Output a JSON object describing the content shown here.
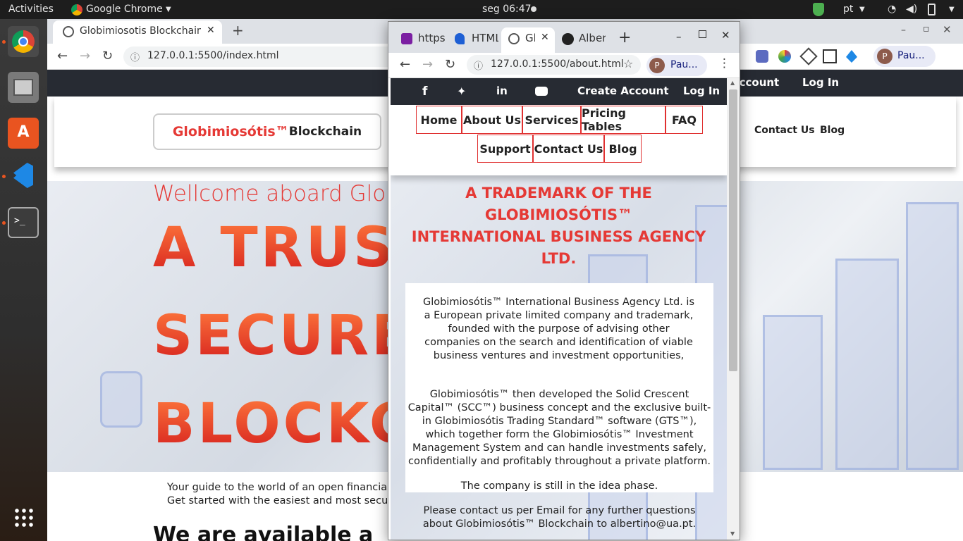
{
  "topbar": {
    "activities": "Activities",
    "app": "Google Chrome",
    "clock": "seg 06:47",
    "lang": "pt"
  },
  "dock": {
    "items": [
      "chrome-icon",
      "files-icon",
      "software-icon",
      "vscode-icon",
      "terminal-icon",
      "apps-grid-icon"
    ]
  },
  "bg": {
    "tab_title": "Globimiosotis Blockchain",
    "url": "127.0.0.1:5500/index.html",
    "profile": "Pau...",
    "nav": {
      "account": "Account",
      "login": "Log In"
    },
    "logo_red": "Globimiosótis™",
    "logo_dark": "Blockchain",
    "header_links": [
      "Contact Us",
      "Blog"
    ],
    "welcome": "Wellcome aboard Globim",
    "hero_lines": [
      "A TRUST",
      "SECURE",
      "BLOCKC"
    ],
    "guide1": "Your guide to the world of an open financial s",
    "guide2": "Get started with the easiest and most secure",
    "available": "We are available a"
  },
  "fg": {
    "tabs": [
      "https",
      "HTML",
      "Gl",
      "Alber"
    ],
    "url": "127.0.0.1:5500/about.html",
    "profile": "Pau...",
    "nav": {
      "create": "Create Account",
      "login": "Log In"
    },
    "menu": [
      "Home",
      "About Us",
      "Services",
      "Pricing Tables",
      "FAQ",
      "Support",
      "Contact Us",
      "Blog"
    ],
    "trademark": [
      "A TRADEMARK OF THE",
      "GLOBIMIOSÓTIS™",
      "INTERNATIONAL BUSINESS AGENCY",
      "LTD."
    ],
    "p1": "Globimiosótis™ International Business Agency Ltd. is a European private limited company and trademark, founded with the purpose of advising other companies on the search and identification of viable business ventures and investment opportunities,",
    "p2": "Globimiosótis™ then developed the Solid Crescent Capital™ (SCC™) business concept and the exclusive built-in Globimiosótis Trading Standard™ software (GTS™), which together form the Globimiosótis™ Investment Management System and can handle investments safely, confidentially and profitably throughout a private platform.",
    "p3": "The company is still in the idea phase.",
    "p4": "Please contact us per Email for any further questions about Globimiosótis™ Blockchain to albertino@ua.pt."
  },
  "colors": {
    "accent": "#e53935",
    "nav": "#272b33",
    "ubuntu": "#e95420"
  }
}
